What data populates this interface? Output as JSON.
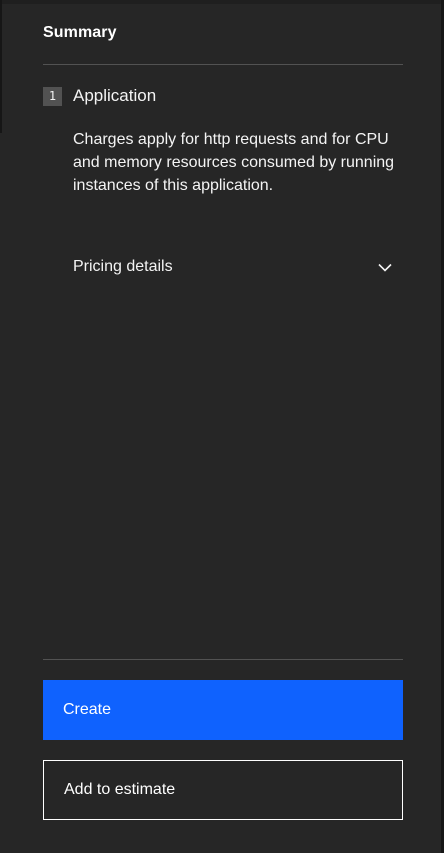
{
  "summary": {
    "title": "Summary",
    "step": {
      "number": "1",
      "label": "Application"
    },
    "description": "Charges apply for http requests and for CPU and memory resources consumed by running instances of this application.",
    "pricing_details": {
      "label": "Pricing details",
      "icon": "chevron-down-icon",
      "expanded": false
    }
  },
  "actions": {
    "create_label": "Create",
    "add_to_estimate_label": "Add to estimate"
  },
  "colors": {
    "background": "#262626",
    "primary": "#0f62fe",
    "divider": "#525252",
    "text": "#f4f4f4"
  }
}
